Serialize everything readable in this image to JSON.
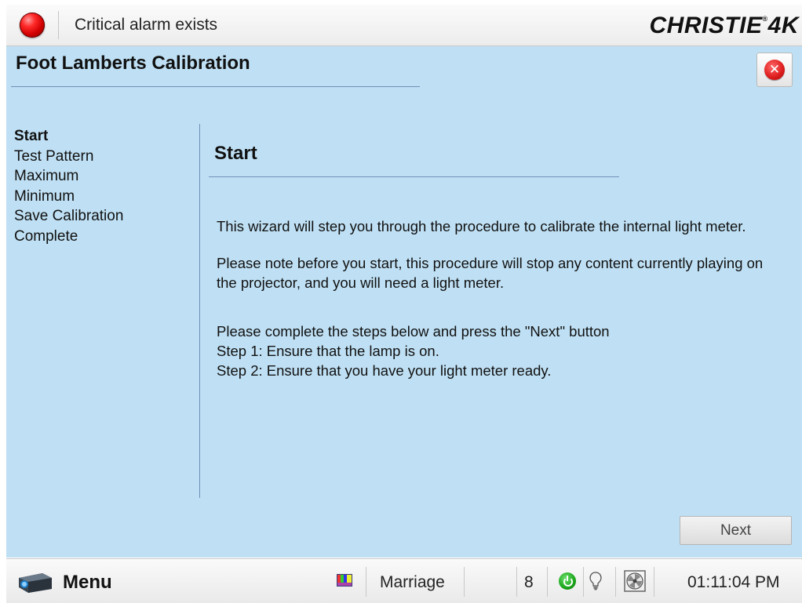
{
  "header": {
    "alarm_text": "Critical alarm exists",
    "brand": "CHRISTIE",
    "brand_suffix": "4K",
    "brand_mark": "®"
  },
  "page": {
    "title": "Foot Lamberts Calibration"
  },
  "steps": [
    {
      "label": "Start",
      "active": true
    },
    {
      "label": "Test Pattern",
      "active": false
    },
    {
      "label": "Maximum",
      "active": false
    },
    {
      "label": "Minimum",
      "active": false
    },
    {
      "label": "Save Calibration",
      "active": false
    },
    {
      "label": "Complete",
      "active": false
    }
  ],
  "section": {
    "title": "Start",
    "para1": "This wizard will step you through the procedure to calibrate the internal light meter.",
    "para2": "Please note before you start, this procedure will stop any content currently playing on the projector, and you will need a light meter.",
    "instruction": "Please complete the steps below and press the \"Next\" button",
    "step1": "Step 1: Ensure that the lamp is on.",
    "step2": "Step 2: Ensure that you have your light meter ready."
  },
  "buttons": {
    "next": "Next"
  },
  "status_bar": {
    "menu_label": "Menu",
    "marriage_label": "Marriage",
    "count": "8",
    "time": "01:11:04 PM"
  },
  "icons": {
    "alarm": "alarm-led-icon",
    "close": "close-icon",
    "projector": "projector-icon",
    "test_pattern": "test-pattern-icon",
    "power": "power-icon",
    "lamp": "lightbulb-icon",
    "cooling": "cooling-fan-icon"
  },
  "colors": {
    "background": "#bfe0f4",
    "alarm": "#d10000",
    "power_ok": "#1aa51a",
    "rule": "#6f8fb8"
  }
}
